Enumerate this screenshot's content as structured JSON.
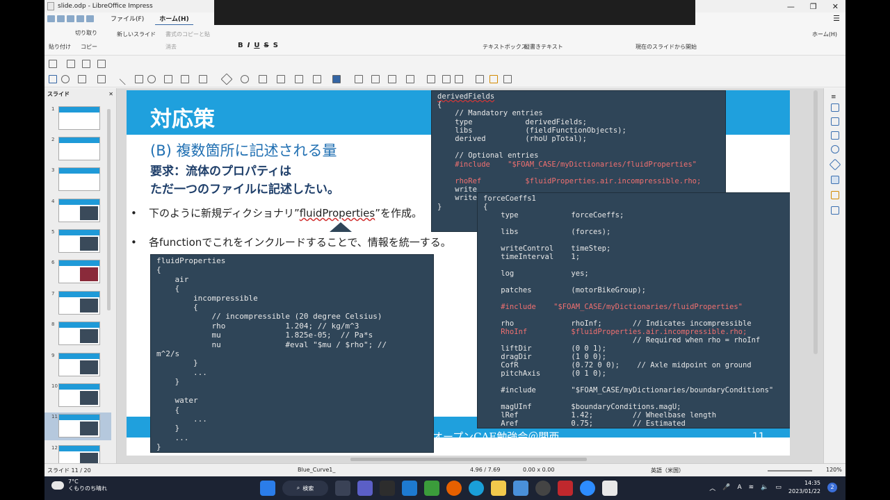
{
  "window": {
    "title": "slide.odp - LibreOffice Impress"
  },
  "menu": {
    "tabs": [
      "ファイル(F)",
      "ホーム(H)"
    ],
    "active": "ホーム(H)"
  },
  "ribbon": {
    "cut": "切り取り",
    "paste": "貼り付け",
    "copy": "コピー",
    "new_slide": "新しいスライド",
    "clone_format": "書式のコピーと貼",
    "clear": "消去",
    "textbox": "テキストボックス",
    "vertical_text": "縦書きテキスト",
    "start_current": "現在のスライドから開始",
    "home_dropdown": "ホーム(H)",
    "format_buttons": [
      "B",
      "I",
      "U",
      "S",
      "S"
    ]
  },
  "slide_panel": {
    "header": "スライド",
    "thumbnails": [
      "1",
      "2",
      "3",
      "4",
      "5",
      "6",
      "7",
      "8",
      "9",
      "10",
      "11",
      "12"
    ],
    "selected": "11"
  },
  "slide": {
    "title": "対応策",
    "subtitle": "(B) 複数箇所に記述される量",
    "requirement_line1": "要求：流体のプロパティは",
    "requirement_line2": "ただ一つのファイルに記述したい。",
    "bullet1_pre": "下のように新規ディクショナリ”",
    "bullet1_word": "fluidProperties",
    "bullet1_post": "”を作成。",
    "bullet2": "各functionでこれをインクルードすることで、情報を統一する。",
    "footer": "オープンCAE勉強会＠関西",
    "page_number": "11",
    "code_fluid": {
      "head": "fluidProperties",
      "body": "{\n    air\n    {\n        incompressible\n        {\n            // incompressible (20 degree Celsius)\n            rho             1.204; // kg/m^3\n            mu              1.825e-05;  // Pa*s\n            nu              #eval \"$mu / $rho\"; //\nm^2/s\n        }\n        ...\n    }\n\n    water\n    {\n        ...\n    }\n    ...\n}"
    },
    "code_derived": {
      "head": "derivedFields",
      "body": "{\n    // Mandatory entries\n    type            derivedFields;\n    libs            (fieldFunctionObjects);\n    derived         (rhoU pTotal);\n\n    // Optional entries",
      "include": "    #include    \"$FOAM_CASE/myDictionaries/fluidProperties\"",
      "rhoref": "    rhoRef          $fluidProperties.air.incompressible.rho;",
      "tail": "\n    write\n    write\n}"
    },
    "code_force": {
      "head": "forceCoeffs1",
      "part1": "{\n    type            forceCoeffs;\n\n    libs            (forces);\n\n    writeControl    timeStep;\n    timeInterval    1;\n\n    log             yes;\n\n    patches         (motorBikeGroup);\n",
      "include1": "    #include    \"$FOAM_CASE/myDictionaries/fluidProperties\"",
      "part2": "\n    rho             rhoInf;       // Indicates incompressible",
      "rhoinf": "    RhoInf          $fluidProperties.air.incompressible.rho;",
      "part3": "                                  // Required when rho = rhoInf\n    liftDir         (0 0 1);\n    dragDir         (1 0 0);\n    CofR            (0.72 0 0);    // Axle midpoint on ground\n    pitchAxis       (0 1 0);\n\n    #include        \"$FOAM_CASE/myDictionaries/boundaryConditions\"\n\n    magUInf         $boundaryConditions.magU;\n    lRef            1.42;         // Wheelbase length\n    Aref            0.75;         // Estimated"
    }
  },
  "status": {
    "slide": "スライド 11 / 20",
    "master": "Blue_Curve1_",
    "position": "4.96 / 7.69",
    "size": "0.00 x 0.00",
    "language": "英語（米国）",
    "zoom": "120%"
  },
  "taskbar": {
    "temp": "7°C",
    "weather": "くもりのち晴れ",
    "search": "検索",
    "time": "14:35",
    "date": "2023/01/22",
    "notifications": "2"
  }
}
